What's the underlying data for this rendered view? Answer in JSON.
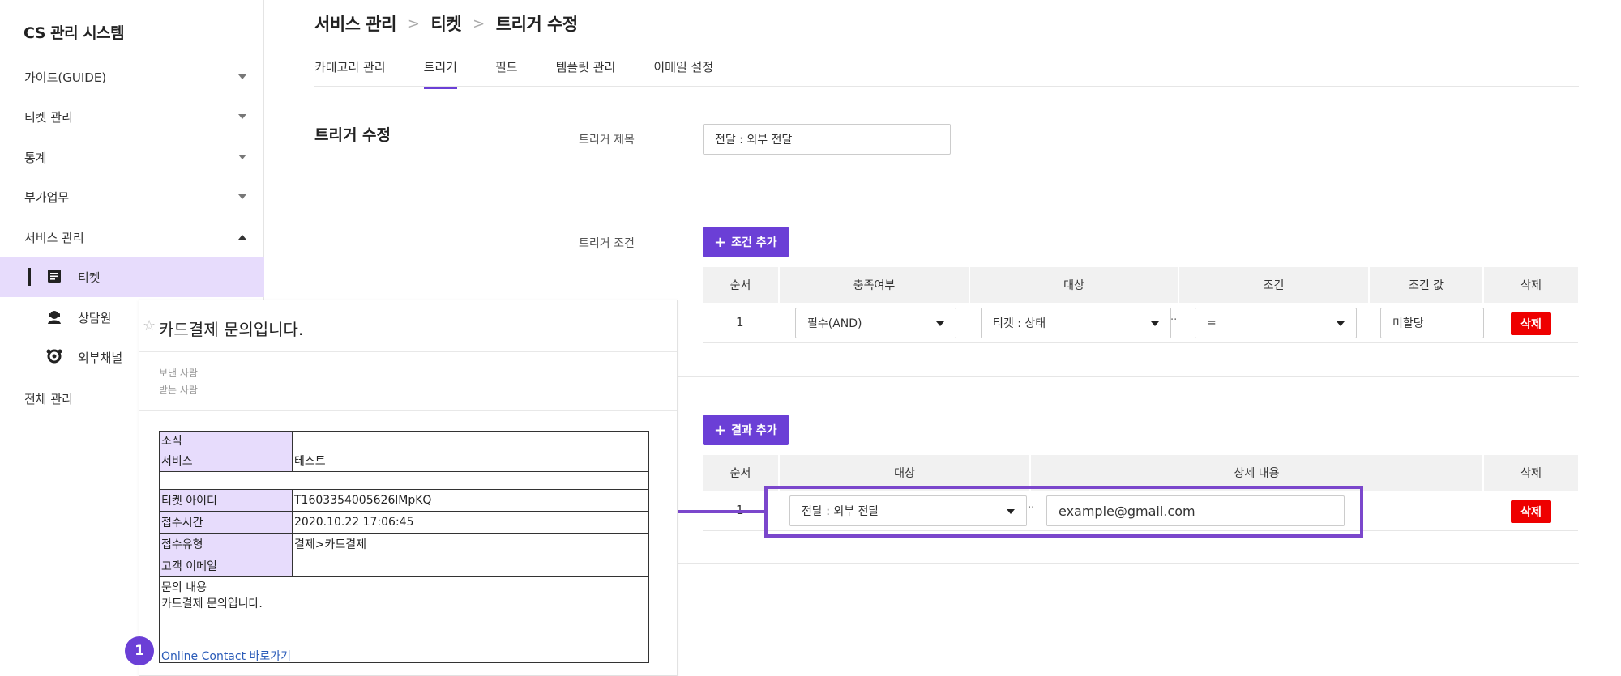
{
  "sidebar": {
    "title": "CS 관리 시스템",
    "items": [
      {
        "label": "가이드(GUIDE)"
      },
      {
        "label": "티켓 관리"
      },
      {
        "label": "통계"
      },
      {
        "label": "부가업무"
      },
      {
        "label": "서비스 관리"
      }
    ],
    "sub_items": [
      {
        "label": "티켓",
        "icon": "document-icon"
      },
      {
        "label": "상담원",
        "icon": "agent-icon"
      },
      {
        "label": "외부채널",
        "icon": "channel-icon"
      }
    ],
    "bottom_item": "전체 관리"
  },
  "header": {
    "breadcrumb": [
      "서비스 관리",
      "티켓",
      "트리거 수정"
    ],
    "tabs": [
      "카테고리 관리",
      "트리거",
      "필드",
      "템플릿 관리",
      "이메일 설정"
    ],
    "active_tab": "트리거"
  },
  "form": {
    "section_title": "트리거 수정",
    "title_label": "트리거 제목",
    "title_value": "전달 : 외부 전달",
    "condition_label": "트리거 조건",
    "add_condition": "조건 추가",
    "condition_headers": [
      "순서",
      "충족여부",
      "대상",
      "조건",
      "조건 값",
      "삭제"
    ],
    "condition_row": {
      "order": "1",
      "fulfill": "필수(AND)",
      "target": "티켓 : 상태",
      "op": "=",
      "value": "미할당",
      "delete": "삭제"
    },
    "add_result": "결과 추가",
    "result_headers": [
      "순서",
      "대상",
      "상세 내용",
      "삭제"
    ],
    "result_row": {
      "order": "1",
      "target": "전달 : 외부 전달",
      "detail": "example@gmail.com",
      "delete": "삭제"
    }
  },
  "email": {
    "subject": "카드결제 문의입니다.",
    "sender_label": "보낸 사람",
    "receiver_label": "받는 사람",
    "rows": [
      {
        "key": "조직",
        "value": ""
      },
      {
        "key": "서비스",
        "value": "테스트"
      },
      {
        "key": "티켓 아이디",
        "value": "T1603354005626lMpKQ"
      },
      {
        "key": "접수시간",
        "value": "2020.10.22 17:06:45"
      },
      {
        "key": "접수유형",
        "value": "결제>카드결제"
      },
      {
        "key": "고객 이메일",
        "value": ""
      }
    ],
    "body_label": "문의 내용",
    "body_text": "카드결제 문의입니다.",
    "link": "Online Contact 바로가기",
    "badge": "1"
  },
  "colors": {
    "accent": "#6b3fd6",
    "active_bg": "#e7dcfc",
    "delete": "#ee0000"
  }
}
